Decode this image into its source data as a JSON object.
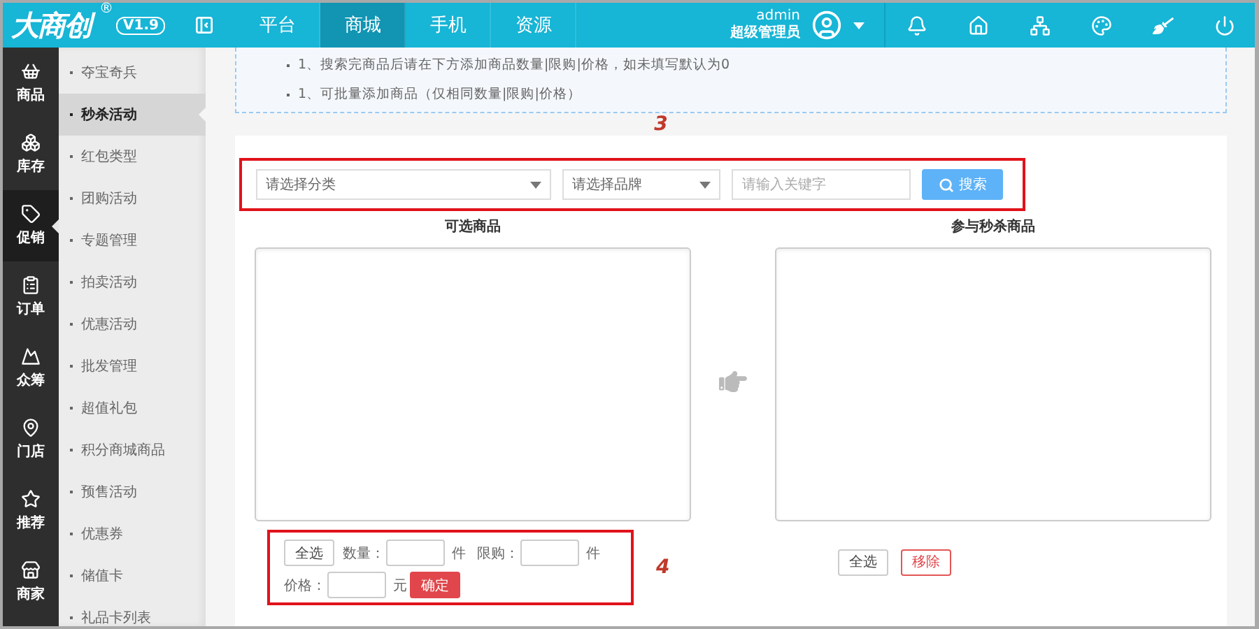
{
  "header": {
    "logo": "大商创",
    "logo_mark": "®",
    "version": "V1.9",
    "nav": [
      {
        "label": "平台",
        "selected": false
      },
      {
        "label": "商城",
        "selected": true
      },
      {
        "label": "手机",
        "selected": false
      },
      {
        "label": "资源",
        "selected": false
      }
    ],
    "user": {
      "name": "admin",
      "role": "超级管理员"
    },
    "tools": [
      {
        "kind": "bell"
      },
      {
        "kind": "home"
      },
      {
        "kind": "sitemap"
      },
      {
        "kind": "palette"
      },
      {
        "kind": "broom"
      },
      {
        "kind": "power"
      }
    ]
  },
  "sidebar": {
    "items": [
      {
        "label": "商品",
        "kind": "basket",
        "selected": false
      },
      {
        "label": "库存",
        "kind": "boxes",
        "selected": false
      },
      {
        "label": "促销",
        "kind": "tag",
        "selected": true
      },
      {
        "label": "订单",
        "kind": "clipboard",
        "selected": false
      },
      {
        "label": "众筹",
        "kind": "peak",
        "selected": false
      },
      {
        "label": "门店",
        "kind": "pin",
        "selected": false
      },
      {
        "label": "推荐",
        "kind": "star",
        "selected": false
      },
      {
        "label": "商家",
        "kind": "store",
        "selected": false
      }
    ]
  },
  "submenu": {
    "items": [
      {
        "label": "夺宝奇兵",
        "selected": false
      },
      {
        "label": "秒杀活动",
        "selected": true
      },
      {
        "label": "红包类型",
        "selected": false
      },
      {
        "label": "团购活动",
        "selected": false
      },
      {
        "label": "专题管理",
        "selected": false
      },
      {
        "label": "拍卖活动",
        "selected": false
      },
      {
        "label": "优惠活动",
        "selected": false
      },
      {
        "label": "批发管理",
        "selected": false
      },
      {
        "label": "超值礼包",
        "selected": false
      },
      {
        "label": "积分商城商品",
        "selected": false
      },
      {
        "label": "预售活动",
        "selected": false
      },
      {
        "label": "优惠券",
        "selected": false
      },
      {
        "label": "储值卡",
        "selected": false
      },
      {
        "label": "礼品卡列表",
        "selected": false
      }
    ]
  },
  "tips": [
    "1、搜索完商品后请在下方添加商品数量|限购|价格，如未填写默认为0",
    "1、可批量添加商品（仅相同数量|限购|价格）"
  ],
  "annotations": [
    "3",
    "4"
  ],
  "search": {
    "category_placeholder": "请选择分类",
    "brand_placeholder": "请选择品牌",
    "keyword_placeholder": "请输入关键字",
    "button": "搜索"
  },
  "left_list": {
    "title": "可选商品"
  },
  "right_list": {
    "title": "参与秒杀商品"
  },
  "batch": {
    "select_all": "全选",
    "quantity_label": "数量：",
    "quantity_unit": "件",
    "limit_label": "限购：",
    "limit_unit": "件",
    "price_label": "价格：",
    "price_unit": "元",
    "confirm": "确定"
  },
  "right_actions": {
    "select_all": "全选",
    "remove": "移除"
  }
}
